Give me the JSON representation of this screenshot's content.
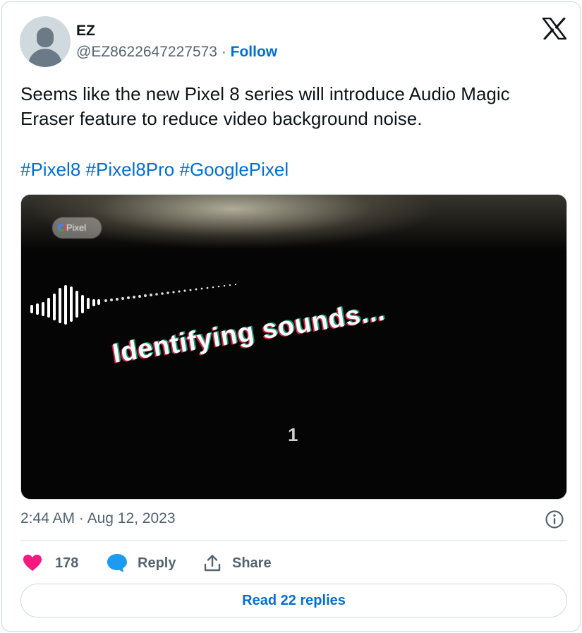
{
  "author": {
    "name": "EZ",
    "handle": "@EZ8622647227573",
    "separator": " · ",
    "follow_label": "Follow"
  },
  "brand_icon": "x-logo-icon",
  "tweet": {
    "text": "Seems like the new Pixel 8 series will introduce Audio Magic Eraser feature to reduce video background noise.",
    "hashtags": [
      "#Pixel8",
      "#Pixel8Pro",
      "#GooglePixel"
    ]
  },
  "media": {
    "pill_text": "Pixel",
    "caption": "Identifying sounds...",
    "counter": "1"
  },
  "timestamp": {
    "time": "2:44 AM",
    "separator": " · ",
    "date": "Aug 12, 2023"
  },
  "actions": {
    "like_count": "178",
    "reply_label": "Reply",
    "share_label": "Share"
  },
  "read_replies_label": "Read 22 replies",
  "colors": {
    "link": "#006fd6",
    "like": "#f91880",
    "reply": "#1d9bf0",
    "muted": "#536471",
    "border": "#cfd9de"
  }
}
